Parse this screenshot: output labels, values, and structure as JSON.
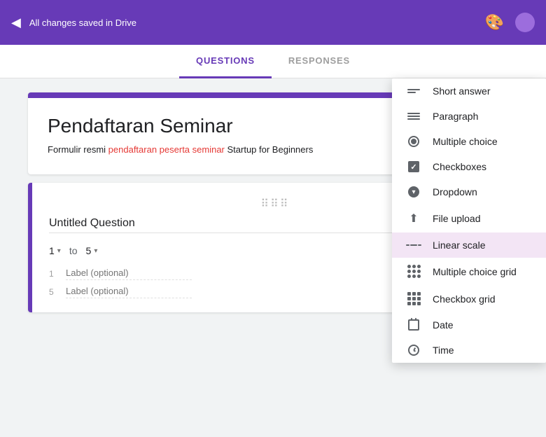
{
  "header": {
    "saved_text": "All changes saved in Drive",
    "back_icon": "◀",
    "palette_icon": "🎨",
    "account_icon": ""
  },
  "tabs": [
    {
      "id": "questions",
      "label": "QUESTIONS",
      "active": true
    },
    {
      "id": "responses",
      "label": "RESPONSES",
      "active": false
    }
  ],
  "form": {
    "title": "Pendaftaran Seminar",
    "description_prefix": "Formulir resmi ",
    "description_highlight": "pendaftaran peserta seminar",
    "description_suffix": " Startup for Beginners"
  },
  "question": {
    "title": "Untitled Question",
    "type": "linear-scale",
    "scale_from": "1",
    "scale_to": "5",
    "label_from_placeholder": "Label (optional)",
    "label_to_placeholder": "Label (optional)",
    "label_from_num": "1",
    "label_to_num": "5"
  },
  "dropdown_menu": {
    "items": [
      {
        "id": "short-answer",
        "label": "Short answer",
        "icon_type": "lines-short"
      },
      {
        "id": "paragraph",
        "label": "Paragraph",
        "icon_type": "lines-para"
      },
      {
        "id": "multiple-choice",
        "label": "Multiple choice",
        "icon_type": "radio"
      },
      {
        "id": "checkboxes",
        "label": "Checkboxes",
        "icon_type": "checkbox"
      },
      {
        "id": "dropdown",
        "label": "Dropdown",
        "icon_type": "dropdown-circle"
      },
      {
        "id": "file-upload",
        "label": "File upload",
        "icon_type": "upload"
      },
      {
        "id": "linear-scale",
        "label": "Linear scale",
        "icon_type": "linear",
        "active": true
      },
      {
        "id": "multiple-choice-grid",
        "label": "Multiple choice grid",
        "icon_type": "grid-circle"
      },
      {
        "id": "checkbox-grid",
        "label": "Checkbox grid",
        "icon_type": "grid-square"
      },
      {
        "id": "date",
        "label": "Date",
        "icon_type": "calendar"
      },
      {
        "id": "time",
        "label": "Time",
        "icon_type": "clock"
      }
    ]
  }
}
